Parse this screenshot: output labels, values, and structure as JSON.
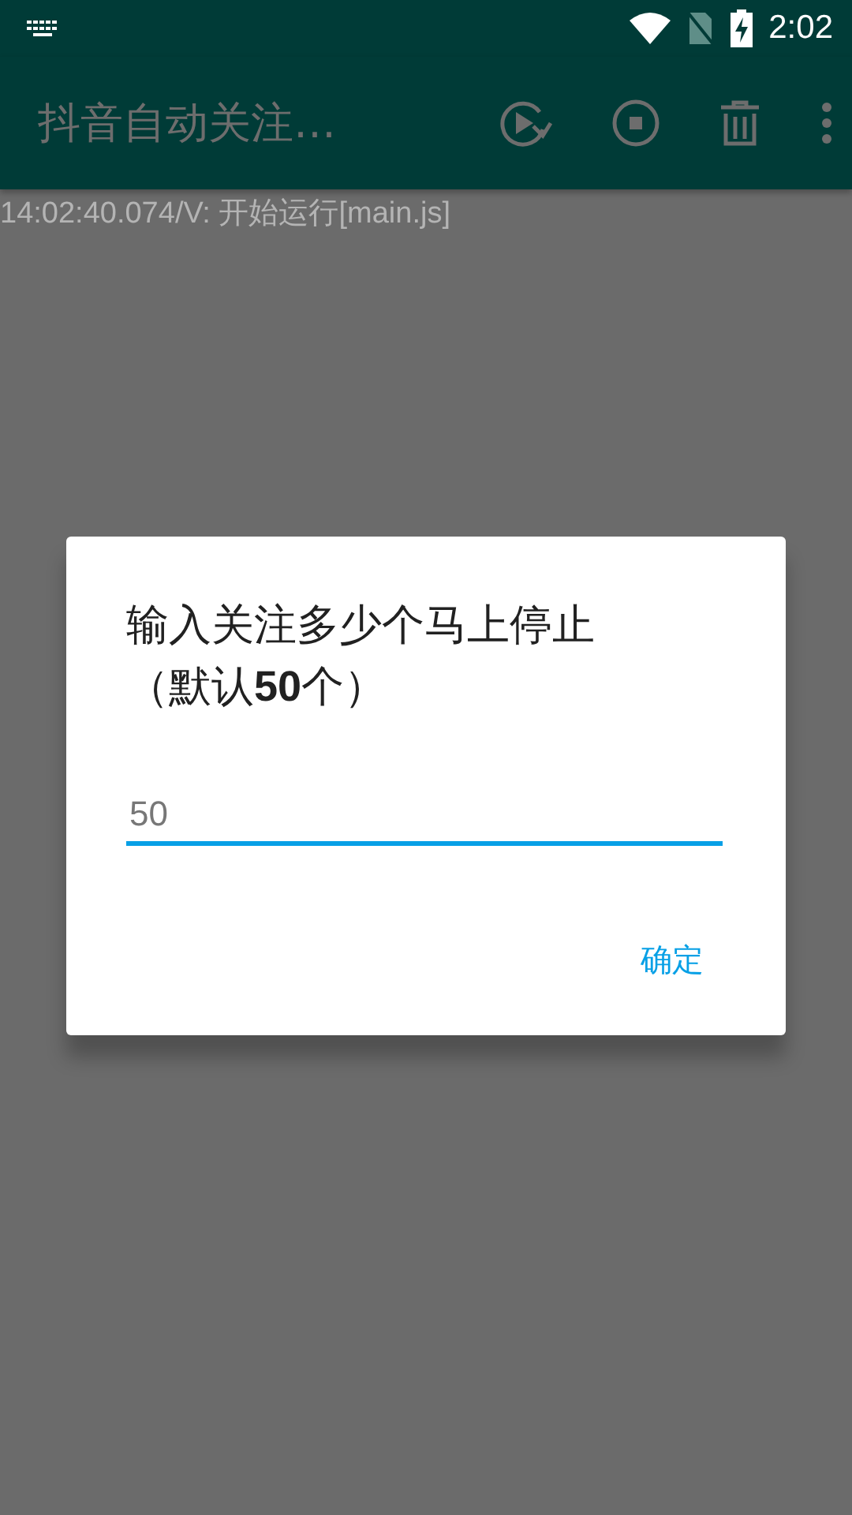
{
  "status_bar": {
    "time": "2:02"
  },
  "toolbar": {
    "title": "抖音自动关注…"
  },
  "log": {
    "lines": [
      "14:02:40.074/V: 开始运行[main.js]"
    ]
  },
  "dialog": {
    "title": "输入关注多少个马上停止（默认**50**个）",
    "input": {
      "placeholder": "50"
    },
    "buttons": [
      "确定"
    ]
  }
}
